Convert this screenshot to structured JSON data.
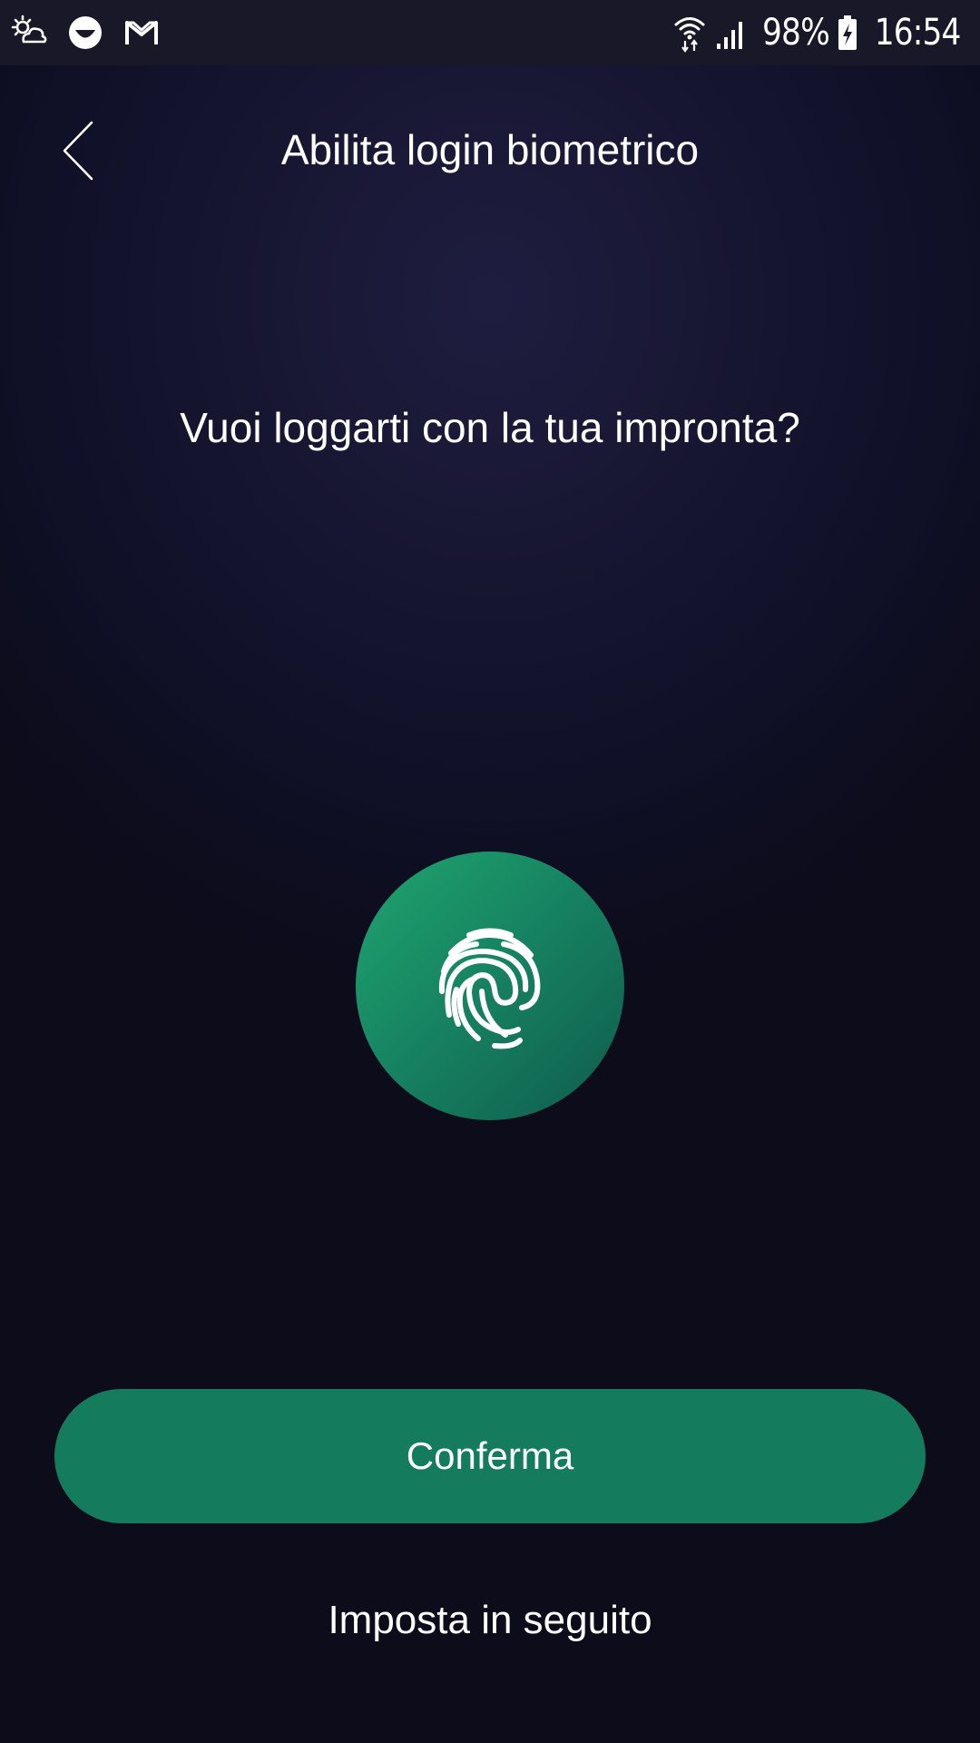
{
  "status_bar": {
    "left_icons": [
      "weather-icon",
      "app-face-icon",
      "gmail-icon"
    ],
    "right_icons": [
      "wifi-icon",
      "signal-icon",
      "battery-charging-icon"
    ],
    "battery": "98%",
    "time": "16:54"
  },
  "header": {
    "back_icon": "chevron-left-icon",
    "title": "Abilita login biometrico"
  },
  "main": {
    "question": "Vuoi loggarti con la tua impronta?",
    "fingerprint_icon": "fingerprint-icon"
  },
  "actions": {
    "confirm_label": "Conferma",
    "later_label": "Imposta in seguito"
  },
  "colors": {
    "background": "#0c0c1b",
    "accent": "#147c5c",
    "accent_light": "#1fa56f"
  }
}
